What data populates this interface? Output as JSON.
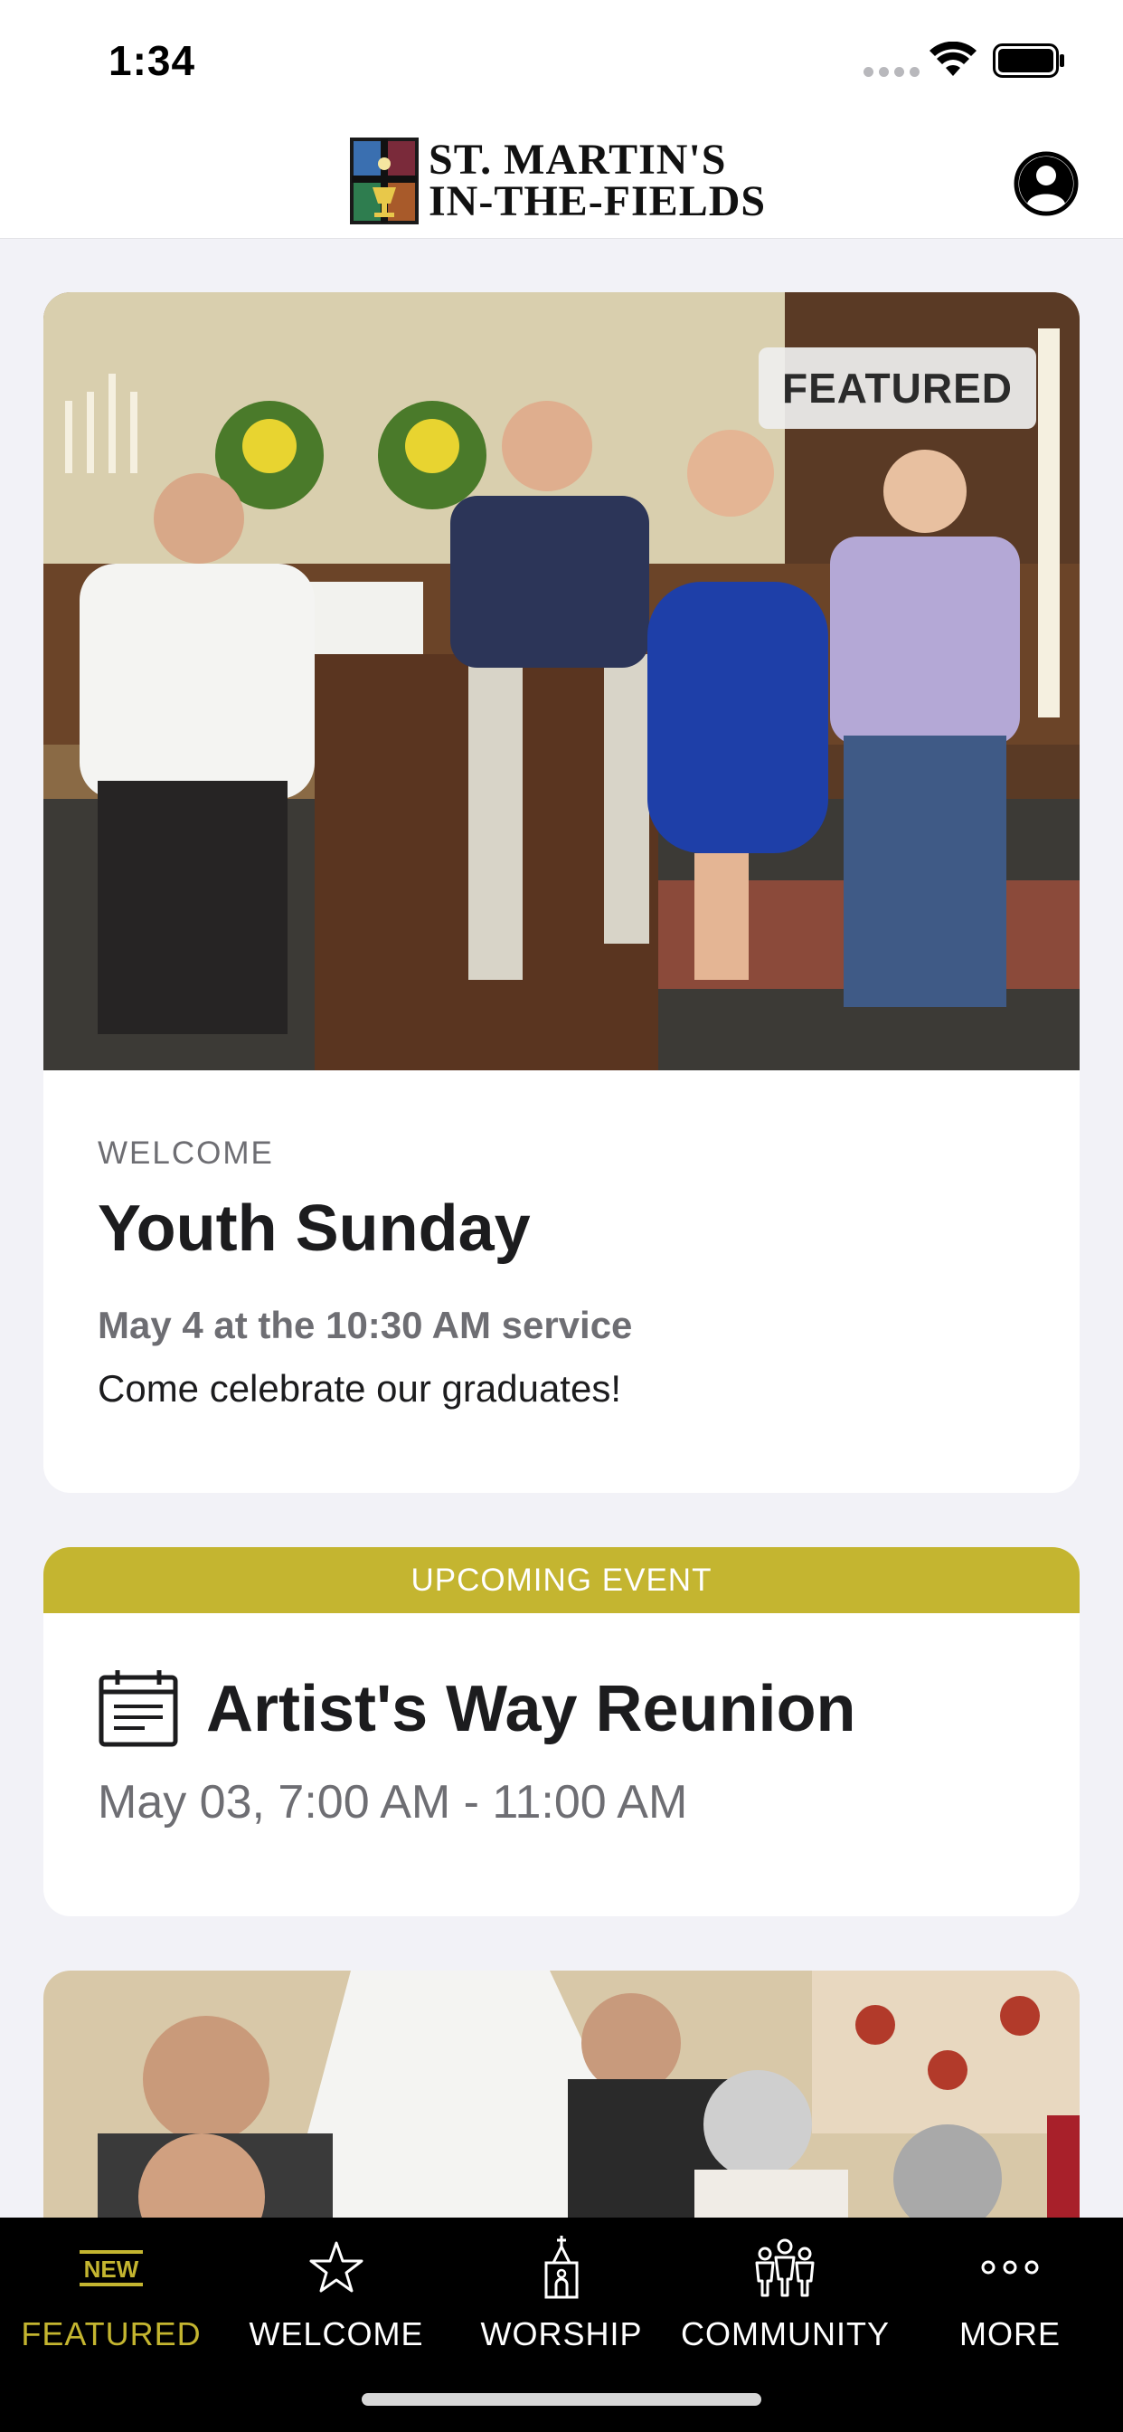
{
  "status_bar": {
    "time": "1:34"
  },
  "header": {
    "logo_line1": "ST. MARTIN'S",
    "logo_line2": "IN-THE-FIELDS",
    "profile_icon": "person-circle-icon"
  },
  "featured": {
    "badge": "FEATURED",
    "kicker": "WELCOME",
    "title": "Youth Sunday",
    "meta": "May 4 at the 10:30 AM service",
    "description": "Come celebrate our graduates!"
  },
  "event": {
    "banner": "UPCOMING EVENT",
    "title": "Artist's Way Reunion",
    "time": "May 03, 7:00 AM - 11:00 AM",
    "icon": "calendar-icon"
  },
  "tabs": [
    {
      "label": "FEATURED",
      "icon": "new-badge-icon",
      "active": true
    },
    {
      "label": "WELCOME",
      "icon": "star-icon",
      "active": false
    },
    {
      "label": "WORSHIP",
      "icon": "church-icon",
      "active": false
    },
    {
      "label": "COMMUNITY",
      "icon": "people-icon",
      "active": false
    },
    {
      "label": "MORE",
      "icon": "more-dots-icon",
      "active": false
    }
  ],
  "tab_badge_text": "NEW",
  "colors": {
    "accent": "#c4b530",
    "tab_bar_bg": "#000000",
    "page_bg": "#f2f2f7"
  }
}
